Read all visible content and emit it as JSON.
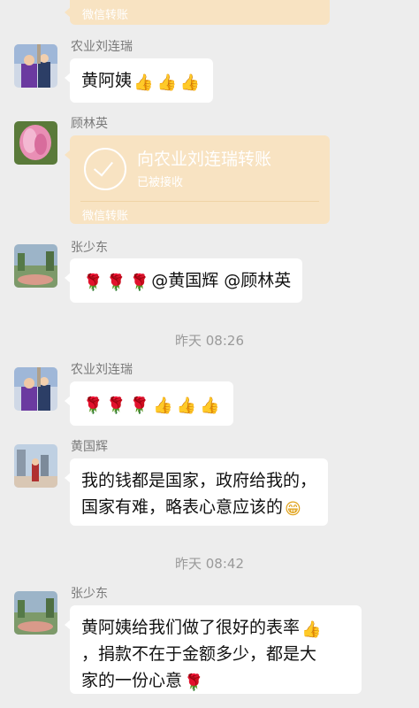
{
  "top_transfer": {
    "footer": "微信转账"
  },
  "messages": [
    {
      "sender": "农业刘连瑞",
      "text": "黄阿姨",
      "emoji_after": [
        "thumbs-up",
        "thumbs-up",
        "thumbs-up"
      ]
    },
    {
      "sender": "顾林英",
      "transfer_title": "向农业刘连瑞转账",
      "transfer_status": "已被接收",
      "transfer_footer": "微信转账"
    },
    {
      "sender": "张少东",
      "text": "@黄国辉 @顾林英",
      "emoji_before": [
        "rose",
        "rose",
        "rose"
      ]
    },
    {
      "sender": "农业刘连瑞",
      "emoji": [
        "rose",
        "rose",
        "rose",
        "thumbs-up",
        "thumbs-up",
        "thumbs-up"
      ]
    },
    {
      "sender": "黄国辉",
      "line1": "我的钱都是国家，政府给我的，",
      "line2": "国家有难，略表心意应该的"
    },
    {
      "sender": "张少东",
      "line1": "黄阿姨给我们做了很好的表率",
      "line2": "，捐款不在于金额多少，都是大",
      "line3": "家的一份心意"
    }
  ],
  "timestamps": [
    "昨天 08:26",
    "昨天 08:42"
  ],
  "icons": {
    "rose": "🌹",
    "thumb": "👍",
    "grin": "😁"
  },
  "colors": {
    "background": "#ededed",
    "bubble": "#ffffff",
    "transfer": "#f8e3c2"
  }
}
